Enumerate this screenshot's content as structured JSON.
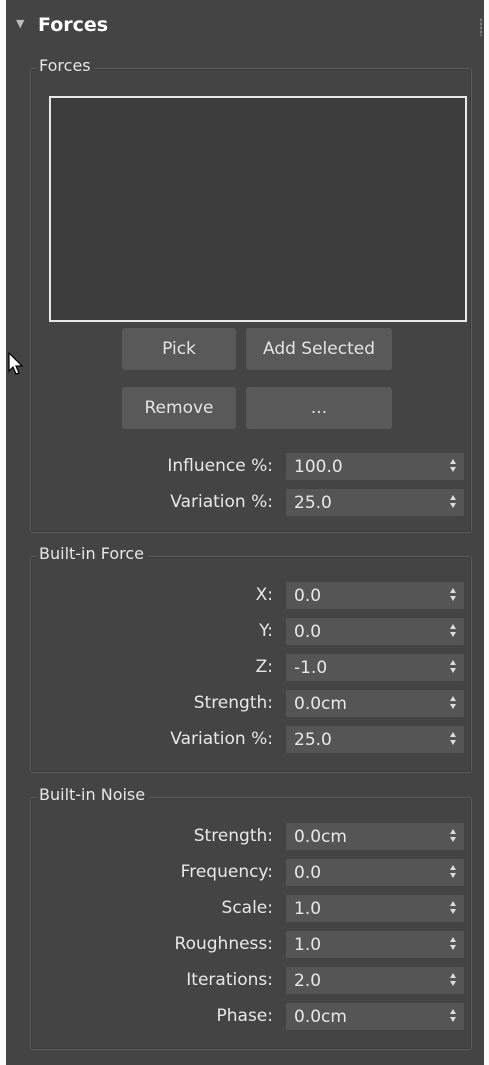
{
  "rollout": {
    "title": "Forces",
    "arrow": "▼"
  },
  "forces_group": {
    "label": "Forces",
    "buttons": {
      "pick": "Pick",
      "add_selected": "Add Selected",
      "remove": "Remove",
      "more": "..."
    },
    "params": [
      {
        "label": "Influence %:",
        "value": "100.0"
      },
      {
        "label": "Variation %:",
        "value": "25.0"
      }
    ]
  },
  "builtin_force_group": {
    "label": "Built-in Force",
    "params": [
      {
        "label": "X:",
        "value": "0.0"
      },
      {
        "label": "Y:",
        "value": "0.0"
      },
      {
        "label": "Z:",
        "value": "-1.0"
      },
      {
        "label": "Strength:",
        "value": "0.0cm"
      },
      {
        "label": "Variation %:",
        "value": "25.0"
      }
    ]
  },
  "builtin_noise_group": {
    "label": "Built-in Noise",
    "params": [
      {
        "label": "Strength:",
        "value": "0.0cm"
      },
      {
        "label": "Frequency:",
        "value": "0.0"
      },
      {
        "label": "Scale:",
        "value": "1.0"
      },
      {
        "label": "Roughness:",
        "value": "1.0"
      },
      {
        "label": "Iterations:",
        "value": "2.0"
      },
      {
        "label": "Phase:",
        "value": "0.0cm"
      }
    ]
  }
}
